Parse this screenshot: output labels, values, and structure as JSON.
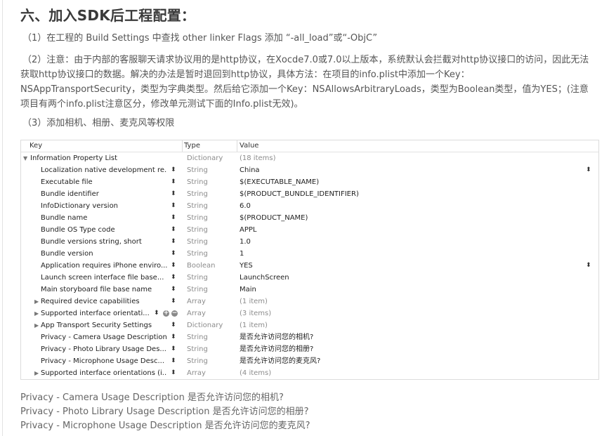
{
  "heading": "六、加入SDK后工程配置：",
  "para1": "（1）在工程的 Build Settings 中查找 other linker Flags 添加 “-all_load”或“-ObjC”",
  "para2": "（2）注意：由于内部的客服聊天请求协议用的是http协议，在Xocde7.0或7.0以上版本，系统默认会拦截对http协议接口的访问，因此无法获取http协议接口的数据。解决的办法是暂时退回到http协议，具体方法：在项目的info.plist中添加一个Key：NSAppTransportSecurity，类型为字典类型。然后给它添加一个Key：NSAllowsArbitraryLoads，类型为Boolean类型，值为YES；(注意项目有两个info.plist注意区分，修改单元测试下面的Info.plist无效)。",
  "para3": "（3）添加相机、相册、麦克风等权限",
  "plist": {
    "headers": {
      "key": "Key",
      "type": "Type",
      "value": "Value"
    },
    "root": {
      "key": "Information Property List",
      "type": "Dictionary",
      "value": "(18 items)"
    },
    "rows": [
      {
        "key": "Localization native development re...",
        "type": "String",
        "value": "China",
        "expand": false,
        "stepper_right": true
      },
      {
        "key": "Executable file",
        "type": "String",
        "value": "$(EXECUTABLE_NAME)",
        "expand": false
      },
      {
        "key": "Bundle identifier",
        "type": "String",
        "value": "$(PRODUCT_BUNDLE_IDENTIFIER)",
        "expand": false
      },
      {
        "key": "InfoDictionary version",
        "type": "String",
        "value": "6.0",
        "expand": false
      },
      {
        "key": "Bundle name",
        "type": "String",
        "value": "$(PRODUCT_NAME)",
        "expand": false
      },
      {
        "key": "Bundle OS Type code",
        "type": "String",
        "value": "APPL",
        "expand": false
      },
      {
        "key": "Bundle versions string, short",
        "type": "String",
        "value": "1.0",
        "expand": false
      },
      {
        "key": "Bundle version",
        "type": "String",
        "value": "1",
        "expand": false
      },
      {
        "key": "Application requires iPhone enviro...",
        "type": "Boolean",
        "value": "YES",
        "expand": false,
        "stepper_right": true
      },
      {
        "key": "Launch screen interface file base...",
        "type": "String",
        "value": "LaunchScreen",
        "expand": false
      },
      {
        "key": "Main storyboard file base name",
        "type": "String",
        "value": "Main",
        "expand": false
      },
      {
        "key": "Required device capabilities",
        "type": "Array",
        "value": "(1 item)",
        "expand": true
      },
      {
        "key": "Supported interface orientati...",
        "type": "Array",
        "value": "(3 items)",
        "expand": true,
        "add_remove": true
      },
      {
        "key": "App Transport Security Settings",
        "type": "Dictionary",
        "value": "(1 item)",
        "expand": true
      },
      {
        "key": "Privacy - Camera Usage Description",
        "type": "String",
        "value": "是否允许访问您的相机?",
        "expand": false
      },
      {
        "key": "Privacy - Photo Library Usage Des...",
        "type": "String",
        "value": "是否允许访问您的相册?",
        "expand": false
      },
      {
        "key": "Privacy - Microphone Usage Desc...",
        "type": "String",
        "value": "是否允许访问您的麦克风?",
        "expand": false
      },
      {
        "key": "Supported interface orientations (i...",
        "type": "Array",
        "value": "(4 items)",
        "expand": true
      }
    ]
  },
  "footer": [
    "Privacy - Camera Usage Description 是否允许访问您的相机?",
    "Privacy - Photo Library Usage Description 是否允许访问您的相册?",
    "Privacy - Microphone Usage Description 是否允许访问您的麦克风?"
  ],
  "icons": {
    "expand": "disclosure-triangle-icon",
    "stepper": "stepper-icon",
    "add": "add-circle-icon",
    "remove": "remove-circle-icon"
  }
}
